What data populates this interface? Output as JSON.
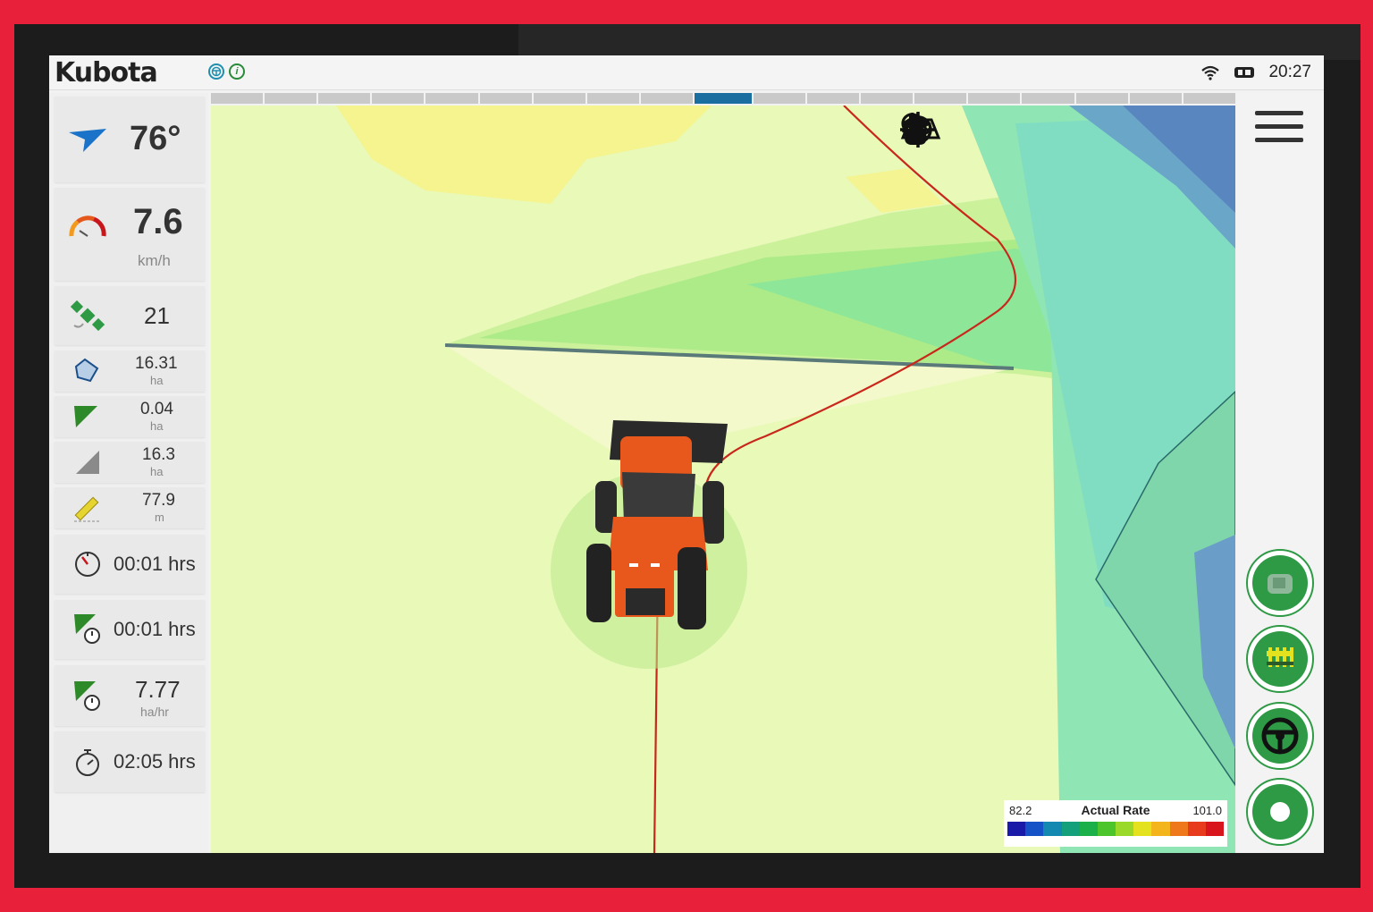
{
  "brand": {
    "logo_text": "Kubota"
  },
  "status_bar": {
    "clock": "20:27"
  },
  "progress_segments": {
    "count": 19,
    "active_index": 9
  },
  "stats": {
    "heading": {
      "value": "76°",
      "icon": "heading-arrow-icon"
    },
    "speed": {
      "value": "7.6",
      "unit": "km/h",
      "icon": "speedometer-icon"
    },
    "satellites": {
      "value": "21",
      "icon": "satellite-icon"
    },
    "field_area": {
      "value": "16.31",
      "unit": "ha",
      "icon": "field-area-icon"
    },
    "applied_area": {
      "value": "0.04",
      "unit": "ha",
      "icon": "applied-area-icon"
    },
    "remaining_area": {
      "value": "16.3",
      "unit": "ha",
      "icon": "remaining-area-icon"
    },
    "distance": {
      "value": "77.9",
      "unit": "m",
      "icon": "ruler-icon"
    },
    "elapsed_time": {
      "value": "00:01 hrs",
      "icon": "timer-icon"
    },
    "work_time": {
      "value": "00:01 hrs",
      "icon": "work-timer-icon"
    },
    "work_rate": {
      "value": "7.77",
      "unit": "ha/hr",
      "icon": "work-rate-icon"
    },
    "time_remaining": {
      "value": "02:05 hrs",
      "icon": "stopwatch-icon"
    }
  },
  "map_tools": [
    "zoom-out-icon",
    "zoom-in-icon",
    "pan-hand-icon",
    "view-3d-icon",
    "center-target-icon",
    "layers-icon"
  ],
  "right_buttons": [
    "implement-icon",
    "section-control-icon",
    "steering-wheel-icon",
    "record-icon"
  ],
  "legend": {
    "title": "Actual Rate",
    "min": "82.2",
    "max": "101.0",
    "colors": [
      "#1a1aa8",
      "#1552c8",
      "#1388b0",
      "#13a07a",
      "#1bb04a",
      "#4cc42c",
      "#9ad82a",
      "#e4e21e",
      "#f4b41c",
      "#f0781c",
      "#e83a1c",
      "#d8141c"
    ]
  },
  "colors": {
    "accent_green": "#2e9a45",
    "brand_red": "#e8203a",
    "active_segment": "#1a6fa0"
  }
}
